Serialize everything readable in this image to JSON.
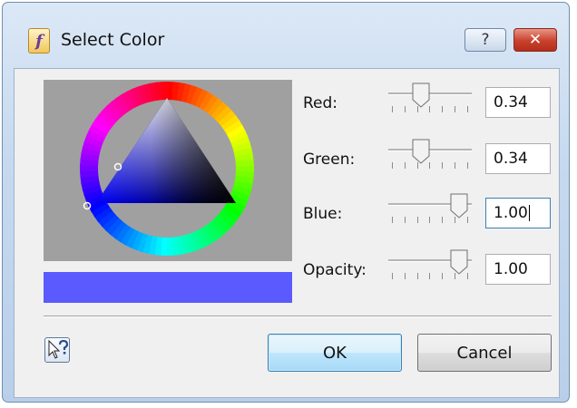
{
  "window": {
    "title": "Select Color",
    "app_icon_glyph": "f",
    "help_glyph": "?",
    "close_glyph": "✕"
  },
  "colors": {
    "preview": "#5a5aff",
    "wheel_background": "#a0a0a0",
    "triangle_hue": "#0000ff"
  },
  "channels": [
    {
      "label": "Red:",
      "value": "0.34",
      "level": 0.34
    },
    {
      "label": "Green:",
      "value": "0.34",
      "level": 0.34
    },
    {
      "label": "Blue:",
      "value": "1.00",
      "level": 1.0,
      "focused": true
    },
    {
      "label": "Opacity:",
      "value": "1.00",
      "level": 1.0
    }
  ],
  "buttons": {
    "ok": "OK",
    "cancel": "Cancel"
  },
  "icons": {
    "whats_this": "whats-this-help-icon"
  }
}
